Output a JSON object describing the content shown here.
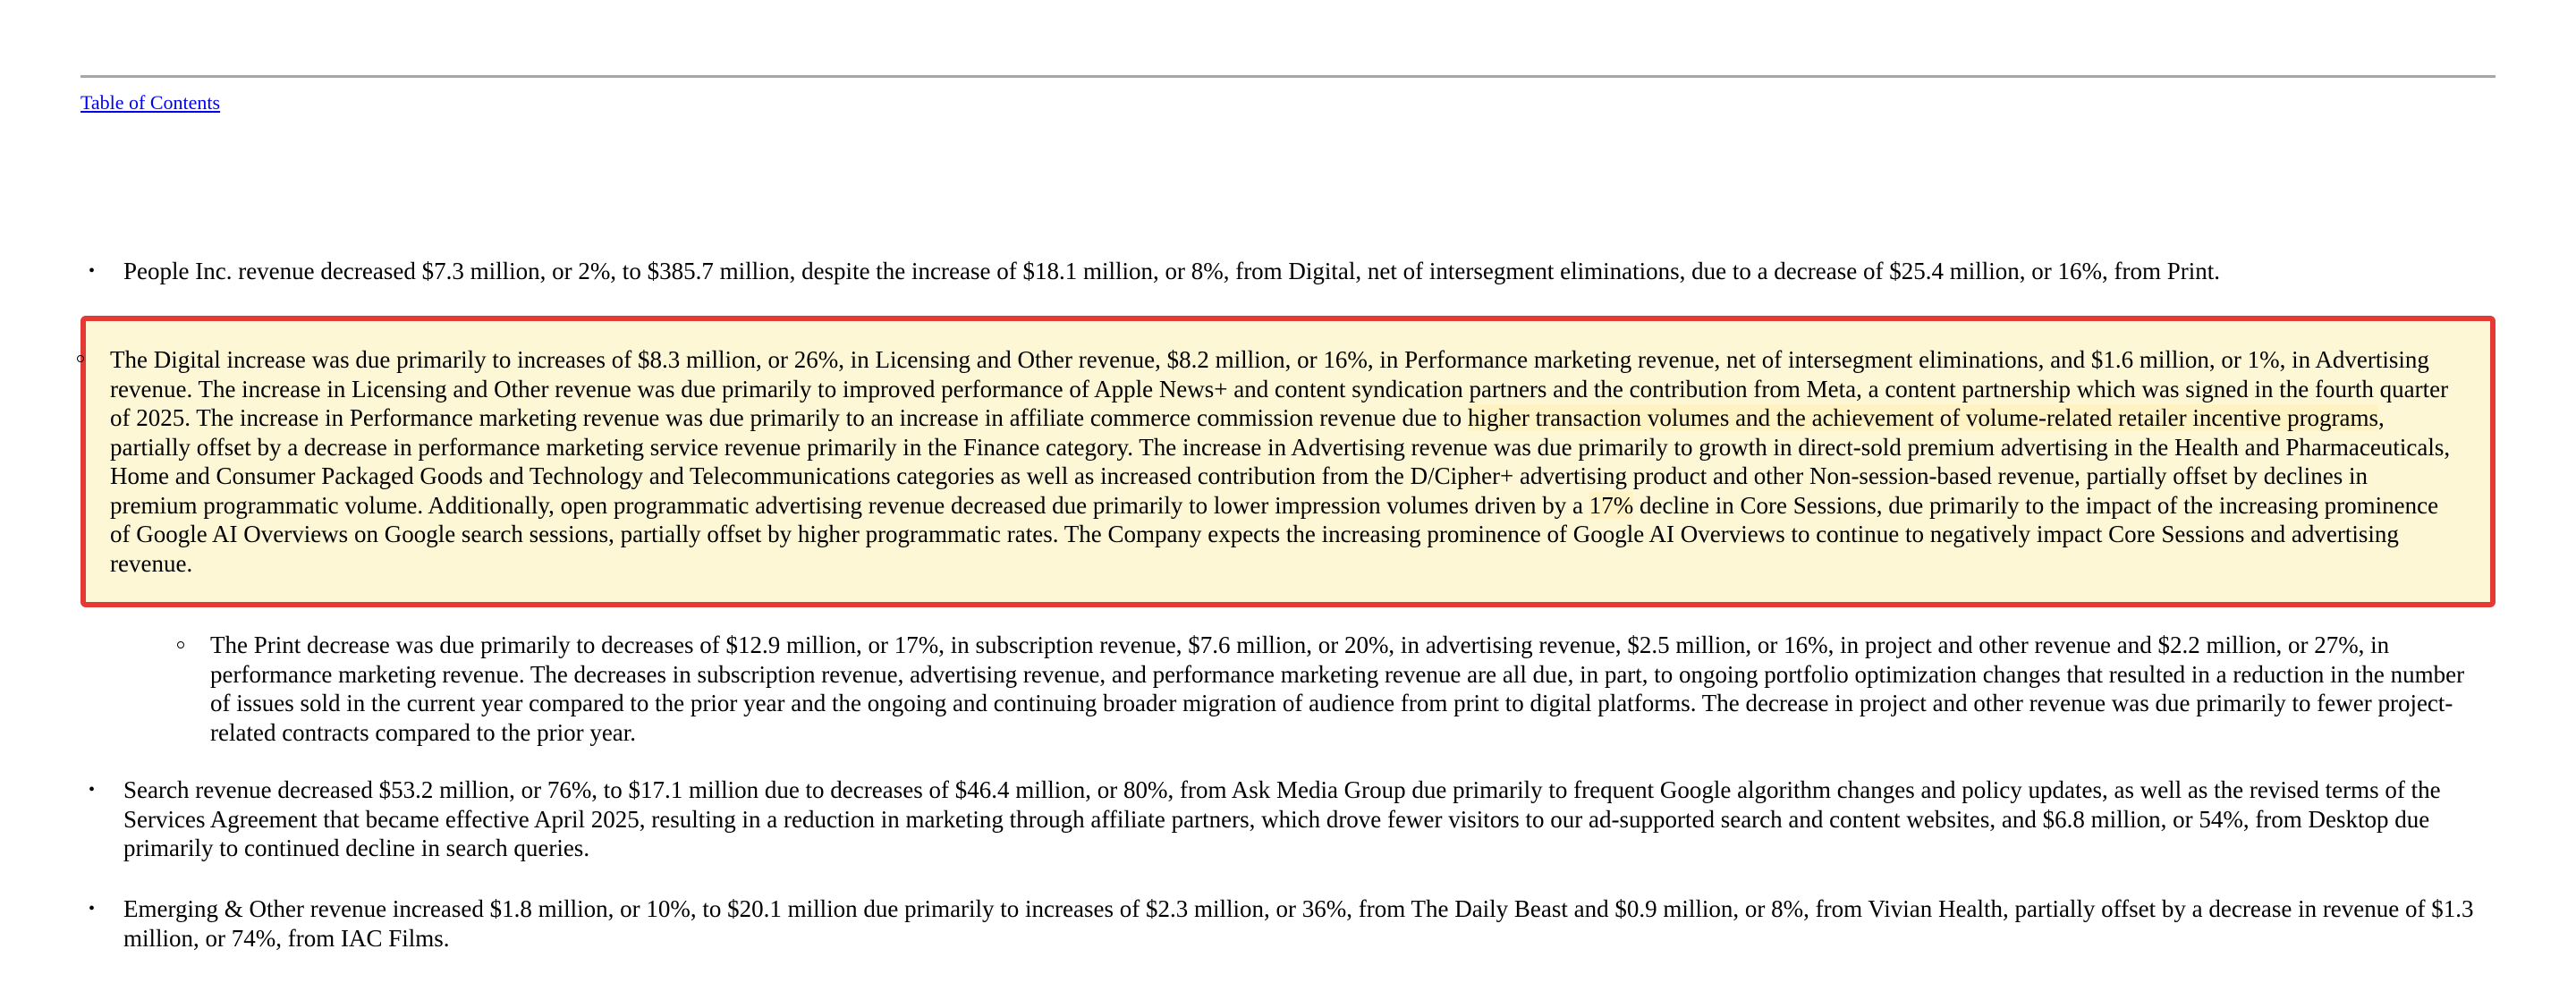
{
  "toc_link": "Table of Contents",
  "paragraphs": {
    "people": "People Inc. revenue decreased $7.3 million, or 2%, to $385.7 million, despite the increase of $18.1 million, or 8%, from Digital, net of intersegment eliminations, due to a decrease of $25.4 million, or 16%, from Print.",
    "digital": {
      "part1": "The Digital increase was due primarily to increases of $8.3 million, or 26%, in Licensing and Other revenue, $8.2 million, or 16%, in Performance marketing revenue, net of intersegment eliminations, and $1.6 million, or 1%, in Advertising revenue. The increase in Licensing and Other revenue was due primarily to improved performance of Apple News+ and content syndication partners and the contribution from Meta, a content partnership which was signed in the fourth quarter of 2025. The increase in Performance marketing revenue was due primarily to an increase in affiliate commerce commission revenue due to ",
      "highlight1": "higher transaction volumes and the achievement of volume-related retailer incentive programs",
      "part2": ", partially offset by a decrease in performance marketing service revenue primarily in the Finance category. The increase in Advertising revenue was due primarily to growth in direct-sold premium advertising in the Health and Pharmaceuticals, Home and Consumer Packaged Goods and Technology and Telecommunications categories as well as increased contribution from the D/Cipher+ advertising product and other Non-session-based revenue, partially offset by declines in premium programmatic volume. Additionally, open programmatic advertising revenue decreased due primarily to lower impression volumes driven by a ",
      "highlight2": "17%",
      "part3": " decline in Core Sessions, due primarily to the impact of the increasing prominence of Google AI Overviews on Google search sessions, partially offset by higher programmatic rates. The Company expects the increasing prominence of Google AI Overviews to continue to negatively impact Core Sessions and advertising revenue."
    },
    "print": "The Print decrease was due primarily to decreases of $12.9 million, or 17%, in subscription revenue, $7.6 million, or 20%, in advertising revenue, $2.5 million, or 16%, in project and other revenue and $2.2 million, or 27%, in performance marketing revenue. The decreases in subscription revenue, advertising revenue, and performance marketing revenue are all due, in part, to ongoing portfolio optimization changes that resulted in a reduction in the number of issues sold in the current year compared to the prior year and the ongoing and continuing broader migration of audience from print to digital platforms. The decrease in project and other revenue was due primarily to fewer project-related contracts compared to the prior year.",
    "search": "Search revenue decreased $53.2 million, or 76%, to $17.1 million due to decreases of $46.4 million, or 80%, from Ask Media Group due primarily to frequent Google algorithm changes and policy updates, as well as the revised terms of the Services Agreement that became effective April 2025, resulting in a reduction in marketing through affiliate partners, which drove fewer visitors to our ad-supported search and content websites, and $6.8 million, or 54%, from Desktop due primarily to continued decline in search queries.",
    "emerging": "Emerging & Other revenue increased $1.8 million, or 10%, to $20.1 million due primarily to increases of $2.3 million, or 36%, from The Daily Beast and $0.9 million, or 8%, from Vivian Health, partially offset by a decrease in revenue of $1.3 million, or 74%, from IAC Films."
  },
  "bullets": {
    "disc": "•"
  },
  "colors": {
    "highlight_border": "#e53935",
    "highlight_fill": "#fdf7d6",
    "link": "#0000ee",
    "rule": "#a6a6a6"
  }
}
